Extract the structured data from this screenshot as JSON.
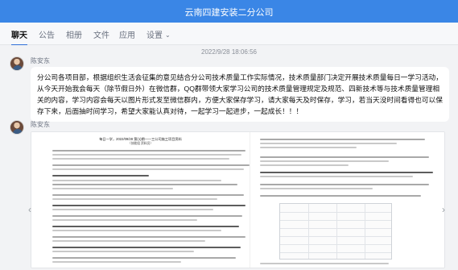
{
  "window": {
    "title": "云南四建安装二分公司"
  },
  "tabs": [
    {
      "label": "聊天"
    },
    {
      "label": "公告"
    },
    {
      "label": "相册"
    },
    {
      "label": "文件"
    },
    {
      "label": "应用"
    },
    {
      "label": "设置"
    }
  ],
  "chat": {
    "timestamp": "2022/9/28 18:06:56",
    "messages": [
      {
        "sender": "陈安东",
        "text": "分公司各项目部，根据组织生活会征集的意见结合分公司技术质量工作实际情况，技术质量部门决定开展技术质量每日一学习活动，从今天开始我会每天（除节假日外）在微信群，QQ群带领大家学习公司的技术质量管理规定及规范、四新技术等与技术质量管理相关的内容，学习内容会每天以图片形式发至微信群内，方便大家保存学习，请大家每天及时保存，学习，若当天没时间看得也可以保存下来，后面抽时间学习，希望大家能认真对待，一起学习一起进步，一起成长！！！"
      },
      {
        "sender": "陈安东",
        "image": {
          "title": "每日一学，2022/09/28 第(1)期——三公司施工项目资料",
          "subtitle": "（技能组 资料员）"
        }
      }
    ]
  },
  "icons": {
    "prev": "chevron-left-icon",
    "next": "chevron-right-icon"
  }
}
